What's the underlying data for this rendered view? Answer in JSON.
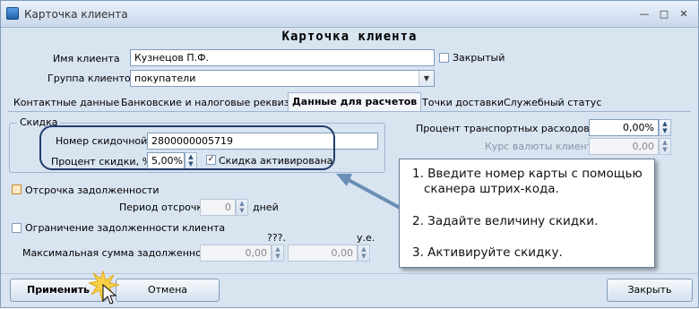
{
  "window": {
    "title": "Карточка клиента"
  },
  "header": {
    "title": "Карточка клиента"
  },
  "client": {
    "name_label": "Имя клиента",
    "name_value": "Кузнецов П.Ф.",
    "closed_label": "Закрытый",
    "group_label": "Группа клиентов",
    "group_value": "покупатели"
  },
  "tabs": [
    {
      "label": "Контактные данные"
    },
    {
      "label": "Банковские и налоговые реквизиты"
    },
    {
      "label": "Данные для расчетов"
    },
    {
      "label": "Точки доставки"
    },
    {
      "label": "Служебный статус"
    }
  ],
  "discount": {
    "group_title": "Скидка",
    "card_label": "Номер скидочной",
    "card_value": "2800000005719",
    "percent_label": "Процент скидки, %",
    "percent_value": "5,00%",
    "activated_label": "Скидка активирована",
    "activated": true
  },
  "transport": {
    "label": "Процент транспортных расходов, %",
    "value": "0,00%"
  },
  "currency": {
    "label": "Курс валюты клиента",
    "value": "0,00"
  },
  "deferral": {
    "label": "Отсрочка задолженности",
    "period_label": "Период отсрочки",
    "period_value": "0",
    "period_unit": "дней"
  },
  "debt_limit": {
    "label": "Ограничение задолженности клиента",
    "max_label": "Максимальная сумма задолженности",
    "col1_header": "???.",
    "col2_header": "у.е.",
    "value1": "0,00",
    "value2": "0,00"
  },
  "callout": {
    "items": [
      "1. Введите номер карты с помощью",
      "сканера штрих-кода.",
      "2. Задайте величину скидки.",
      "3. Активируйте скидку."
    ]
  },
  "buttons": {
    "apply": "Применить",
    "cancel": "Отмена",
    "close": "Закрыть"
  },
  "colors": {
    "window_bg": "#d9e4f1",
    "highlight_border": "#1f3f6e",
    "arrow": "#6a8fb6"
  }
}
